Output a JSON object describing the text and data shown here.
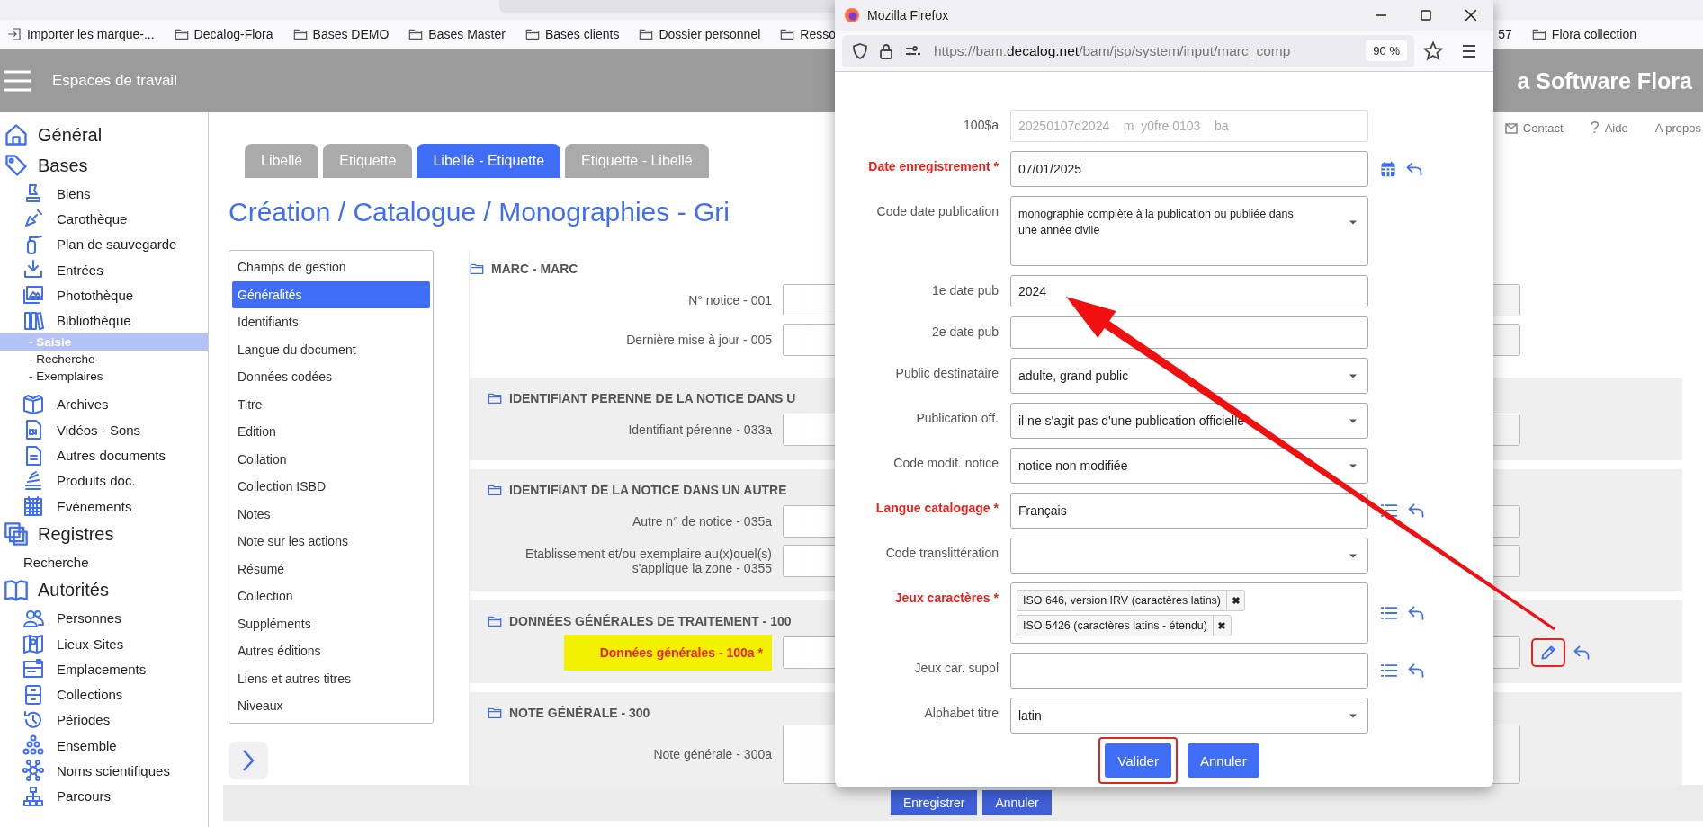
{
  "browser": {
    "bookmarks": [
      {
        "label": "Importer les marque-...",
        "kind": "import"
      },
      {
        "label": "Decalog-Flora",
        "kind": "folder"
      },
      {
        "label": "Bases DEMO",
        "kind": "folder"
      },
      {
        "label": "Bases Master",
        "kind": "folder"
      },
      {
        "label": "Bases clients",
        "kind": "folder"
      },
      {
        "label": "Dossier personnel",
        "kind": "folder"
      },
      {
        "label": "Resso",
        "kind": "folder"
      }
    ],
    "bookmarks_right": [
      {
        "label": "57",
        "kind": "plain"
      },
      {
        "label": "Flora collection",
        "kind": "folder"
      }
    ]
  },
  "header": {
    "title": "Espaces de travail",
    "brand": "a Software Flora"
  },
  "top_links": [
    {
      "label": "Contact",
      "kind": "mail"
    },
    {
      "label": "Aide",
      "kind": "help",
      "glyph": "?"
    },
    {
      "label": "A propos",
      "kind": "plain"
    }
  ],
  "sidebar": {
    "sections": [
      {
        "title": "Général"
      },
      {
        "title": "Bases",
        "items": [
          {
            "label": "Biens",
            "kind": "entry"
          },
          {
            "label": "Carothèque",
            "kind": "entry"
          },
          {
            "label": "Plan de sauvegarde",
            "kind": "entry"
          },
          {
            "label": "Entrées",
            "kind": "entry"
          },
          {
            "label": "Photothèque",
            "kind": "entry"
          },
          {
            "label": "Bibliothèque",
            "kind": "entry",
            "children": [
              {
                "label": "- Saisie",
                "selected": true
              },
              {
                "label": "- Recherche",
                "selected": false
              },
              {
                "label": "- Exemplaires",
                "selected": false
              }
            ]
          },
          {
            "label": "Archives",
            "kind": "entry"
          },
          {
            "label": "Vidéos - Sons",
            "kind": "entry"
          },
          {
            "label": "Autres documents",
            "kind": "entry"
          },
          {
            "label": "Produits doc.",
            "kind": "entry"
          },
          {
            "label": "Evènements",
            "kind": "entry"
          }
        ]
      },
      {
        "title": "Registres",
        "items": [
          {
            "label": "Recherche",
            "kind": "plain"
          }
        ]
      },
      {
        "title": "Autorités",
        "items": [
          {
            "label": "Personnes",
            "kind": "entry"
          },
          {
            "label": "Lieux-Sites",
            "kind": "entry"
          },
          {
            "label": "Emplacements",
            "kind": "entry"
          },
          {
            "label": "Collections",
            "kind": "entry"
          },
          {
            "label": "Périodes",
            "kind": "entry"
          },
          {
            "label": "Ensemble",
            "kind": "entry"
          },
          {
            "label": "Noms scientifiques",
            "kind": "entry"
          },
          {
            "label": "Parcours",
            "kind": "entry"
          }
        ]
      }
    ]
  },
  "tabs": [
    {
      "label": "Libellé",
      "selected": false
    },
    {
      "label": "Etiquette",
      "selected": false
    },
    {
      "label": "Libellé - Etiquette",
      "selected": true
    },
    {
      "label": "Etiquette - Libellé",
      "selected": false
    }
  ],
  "page_title": "Création / Catalogue / Monographies - Gri",
  "nav": [
    {
      "label": "Champs de gestion",
      "selected": false
    },
    {
      "label": "Généralités",
      "selected": true
    },
    {
      "label": "Identifiants",
      "selected": false
    },
    {
      "label": "Langue du document",
      "selected": false
    },
    {
      "label": "Données codées",
      "selected": false
    },
    {
      "label": "Titre",
      "selected": false
    },
    {
      "label": "Edition",
      "selected": false
    },
    {
      "label": "Collation",
      "selected": false
    },
    {
      "label": "Collection ISBD",
      "selected": false
    },
    {
      "label": "Notes",
      "selected": false
    },
    {
      "label": "Note sur les actions",
      "selected": false
    },
    {
      "label": "Résumé",
      "selected": false
    },
    {
      "label": "Collection",
      "selected": false
    },
    {
      "label": "Suppléments",
      "selected": false
    },
    {
      "label": "Autres éditions",
      "selected": false
    },
    {
      "label": "Liens et autres titres",
      "selected": false
    },
    {
      "label": "Niveaux",
      "selected": false
    }
  ],
  "form": {
    "sections": [
      {
        "title": "MARC - MARC",
        "shaded": false,
        "fields": [
          {
            "label": "N° notice - 001",
            "kind": "text",
            "required": false,
            "highlighted": false
          },
          {
            "label": "Dernière mise à jour - 005",
            "kind": "text",
            "required": false,
            "highlighted": false
          }
        ]
      },
      {
        "title": "IDENTIFIANT PERENNE DE LA NOTICE DANS U",
        "shaded": true,
        "fields": [
          {
            "label": "Identifiant pérenne - 033a",
            "kind": "text",
            "required": false,
            "highlighted": false
          }
        ]
      },
      {
        "title": "IDENTIFIANT DE LA NOTICE DANS UN AUTRE",
        "shaded": true,
        "fields": [
          {
            "label": "Autre n° de notice - 035a",
            "kind": "text",
            "required": false,
            "highlighted": false
          },
          {
            "label": "Etablissement et/ou exemplaire au(x)quel(s) s'applique la zone - 0355",
            "kind": "text",
            "required": false,
            "highlighted": false
          }
        ]
      },
      {
        "title": "DONNÉES GÉNÉRALES DE TRAITEMENT - 100",
        "shaded": true,
        "fields": [
          {
            "label": "Données générales - 100a *",
            "kind": "edit",
            "required": true,
            "highlighted": true
          }
        ]
      },
      {
        "title": "NOTE GÉNÉRALE - 300",
        "shaded": true,
        "fields": [
          {
            "label": "Note générale - 300a",
            "kind": "textarea",
            "required": false,
            "highlighted": false
          }
        ]
      }
    ]
  },
  "footer_buttons": [
    "Enregistrer",
    "Annuler"
  ],
  "popup": {
    "window_title": "Mozilla Firefox",
    "url": {
      "prefix": "https://bam.",
      "host": "decalog.net",
      "path": "/bam/jsp/system/input/marc_comp"
    },
    "zoom": "90 %",
    "rows": [
      {
        "label": "100$a",
        "kind": "text",
        "value": "20250107d2024    m  y0fre 0103    ba",
        "required": false,
        "disabled": true
      },
      {
        "label": "Date enregistrement *",
        "kind": "date",
        "value": "07/01/2025",
        "required": true,
        "disabled": false
      },
      {
        "label": "Code date publication",
        "kind": "multiline_select",
        "value": "monographie complète à la publication ou publiée dans une année civile",
        "required": false,
        "disabled": false
      },
      {
        "label": "1e date pub",
        "kind": "text",
        "value": "2024",
        "required": false,
        "disabled": false
      },
      {
        "label": "2e date pub",
        "kind": "text",
        "required": false,
        "disabled": false
      },
      {
        "label": "Public destinataire",
        "kind": "select",
        "value": "adulte, grand public",
        "required": false,
        "disabled": false
      },
      {
        "label": "Publication off.",
        "kind": "select",
        "value": "il ne s'agit pas d'une publication officielle",
        "required": false,
        "disabled": false
      },
      {
        "label": "Code modif. notice",
        "kind": "select",
        "value": "notice non modifiée",
        "required": false,
        "disabled": false
      },
      {
        "label": "Langue catalogage *",
        "kind": "list",
        "value": "Français",
        "required": true,
        "disabled": false
      },
      {
        "label": "Code translittération",
        "kind": "select",
        "required": false,
        "disabled": false
      },
      {
        "label": "Jeux caractères *",
        "kind": "tags",
        "tags": [
          "ISO 646, version IRV (caractères latins)",
          "ISO 5426 (caractères latins - étendu)"
        ],
        "required": true,
        "disabled": false
      },
      {
        "label": "Jeux car. suppl",
        "kind": "list",
        "required": false,
        "disabled": false
      },
      {
        "label": "Alphabet titre",
        "kind": "select",
        "value": "latin",
        "required": false,
        "disabled": false
      }
    ],
    "buttons": [
      {
        "label": "Valider",
        "highlighted": true
      },
      {
        "label": "Annuler",
        "highlighted": false
      }
    ]
  }
}
